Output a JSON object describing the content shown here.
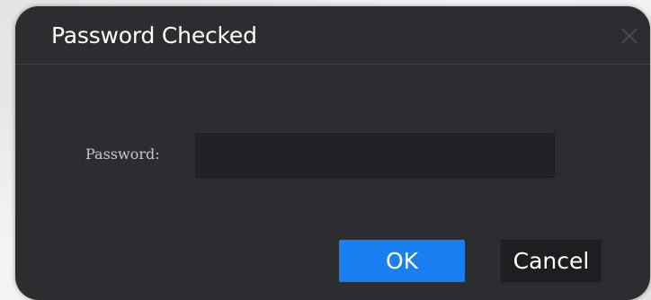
{
  "dialog": {
    "title": "Password Checked",
    "close_icon": "close-icon"
  },
  "form": {
    "password_label": "Password:",
    "password_value": ""
  },
  "buttons": {
    "ok_label": "OK",
    "cancel_label": "Cancel"
  },
  "colors": {
    "dialog_background": "#2c2d31",
    "input_background": "#212226",
    "ok_button": "#1a7ff0",
    "cancel_button": "#1d1e21",
    "text_primary": "#ffffff",
    "text_label": "#c9c9cc"
  }
}
